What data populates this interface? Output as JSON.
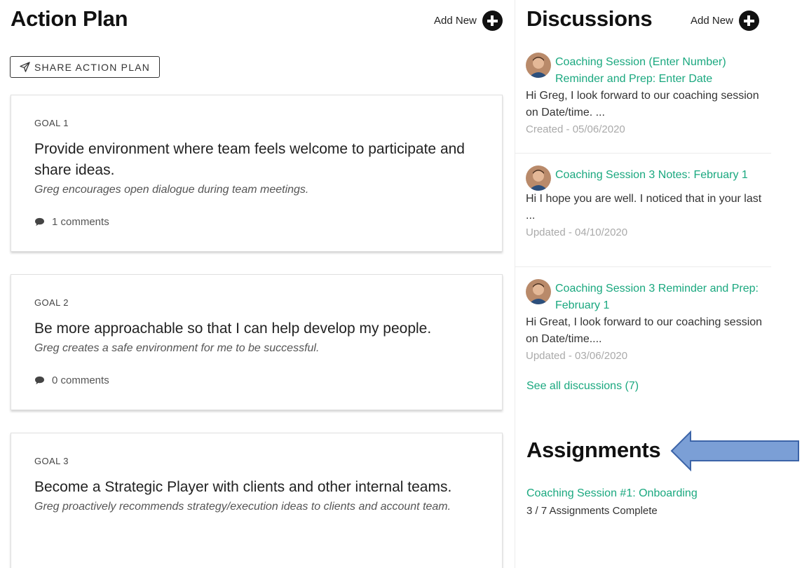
{
  "action_plan": {
    "title": "Action Plan",
    "add_new_label": "Add New",
    "share_label": "SHARE ACTION PLAN",
    "goals": [
      {
        "label": "GOAL 1",
        "title": "Provide environment where team feels welcome to participate and share ideas.",
        "description": "Greg encourages open dialogue during team meetings.",
        "comments": "1 comments"
      },
      {
        "label": "GOAL 2",
        "title": "Be more approachable so that I can help develop my people.",
        "description": "Greg creates a safe environment for me to be successful.",
        "comments": "0 comments"
      },
      {
        "label": "GOAL 3",
        "title": "Become a Strategic Player with clients and other internal teams.",
        "description": "Greg proactively recommends strategy/execution ideas to clients and account team."
      }
    ]
  },
  "discussions": {
    "title": "Discussions",
    "add_new_label": "Add New",
    "items": [
      {
        "title": "Coaching Session (Enter Number) Reminder and Prep: Enter Date",
        "excerpt": "Hi Greg, I look forward to our coaching session on Date/time. ...",
        "meta": "Created - 05/06/2020"
      },
      {
        "title": "Coaching Session 3 Notes: February 1",
        "excerpt": "Hi I hope you are well. I noticed that in your last ...",
        "meta": "Updated - 04/10/2020"
      },
      {
        "title": "Coaching Session 3 Reminder and Prep: February 1",
        "excerpt": "Hi Great, I look forward to our coaching session on Date/time....",
        "meta": "Updated - 03/06/2020"
      }
    ],
    "see_all": "See all discussions (7)"
  },
  "assignments": {
    "title": "Assignments",
    "item_title": "Coaching Session #1: Onboarding",
    "progress_text": "3 / 7 Assignments Complete"
  },
  "colors": {
    "accent_green": "#1aa87f",
    "annotation_arrow_fill": "#7b9fd6",
    "annotation_arrow_stroke": "#3c64a8"
  }
}
